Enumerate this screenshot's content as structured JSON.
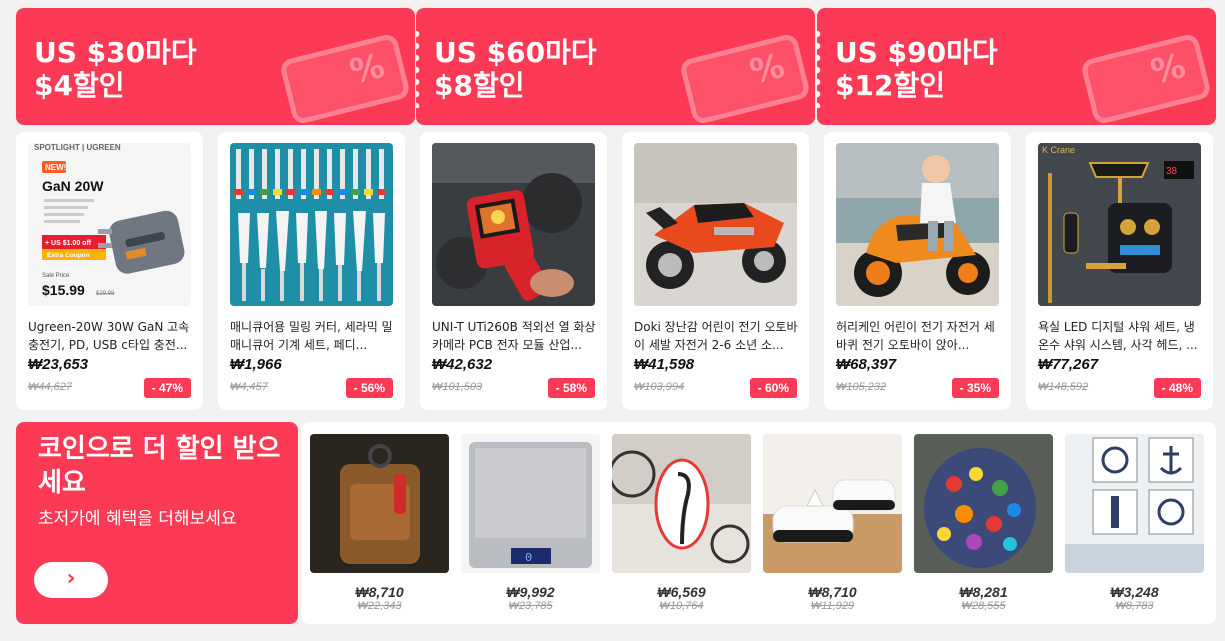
{
  "coupons": [
    {
      "line1": "US $30마다",
      "line2": "$4할인"
    },
    {
      "line1": "US $60마다",
      "line2": "$8할인"
    },
    {
      "line1": "US $90마다",
      "line2": "$12할인"
    }
  ],
  "products": [
    {
      "title": "Ugreen-20W 30W GaN 고속 충전기, PD, USB c타입 충전...",
      "price": "₩23,653",
      "original": "₩44,627",
      "discount": "- 47%",
      "image_text": {
        "brand": "SPOTLIGHT | UGREEN",
        "new": "NEW!",
        "model": "GaN 20W",
        "coupon": "+ US $1.00 off",
        "extra": "Extra Coupon",
        "sale_label": "Sale Price",
        "sale_price": "$15.99",
        "sale_orig": "$29.98"
      }
    },
    {
      "title": "매니큐어용 밀링 커터, 세라믹 밀 매니큐어 기계 세트, 페디...",
      "price": "₩1,966",
      "original": "₩4,457",
      "discount": "- 56%"
    },
    {
      "title": "UNI-T UTi260B 적외선 열 화상 카메라 PCB 전자 모듈 산업...",
      "price": "₩42,632",
      "original": "₩101,503",
      "discount": "- 58%"
    },
    {
      "title": "Doki 장난감 어린이 전기 오토바이 세발 자전거 2-6 소년 소...",
      "price": "₩41,598",
      "original": "₩103,994",
      "discount": "- 60%"
    },
    {
      "title": "허리케인 어린이 전기 자전거 세 바퀴 전기 오토바이 앉아...",
      "price": "₩68,397",
      "original": "₩105,232",
      "discount": "- 35%"
    },
    {
      "title": "욕실 LED 디지털 샤워 세트, 냉온수 샤워 시스템, 사각 헤드, ...",
      "price": "₩77,267",
      "original": "₩148,592",
      "discount": "- 48%",
      "image_text": {
        "brand": "K Crane",
        "temp": "38"
      }
    }
  ],
  "coin": {
    "heading": "코인으로 더 할인 받으세요",
    "subheading": "초저가에 혜택을 더해보세요",
    "button": "›"
  },
  "coin_products": [
    {
      "price": "₩8,710",
      "original": "₩22,343"
    },
    {
      "price": "₩9,992",
      "original": "₩23,785",
      "image_text": "0"
    },
    {
      "price": "₩6,569",
      "original": "₩10,764"
    },
    {
      "price": "₩8,710",
      "original": "₩11,929"
    },
    {
      "price": "₩8,281",
      "original": "₩28,555"
    },
    {
      "price": "₩3,248",
      "original": "₩8,783"
    }
  ],
  "colors": {
    "accent": "#fd3a55",
    "background": "#f2f2f2"
  }
}
